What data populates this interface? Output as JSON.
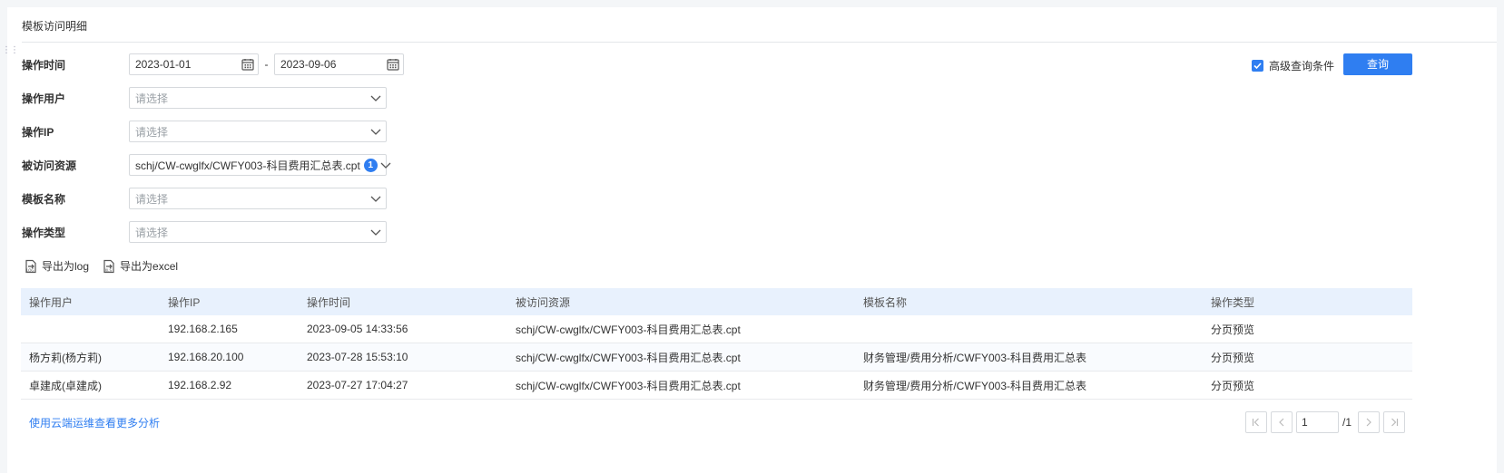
{
  "panel": {
    "title": "模板访问明细"
  },
  "filters": {
    "op_time": {
      "label": "操作时间",
      "start": "2023-01-01",
      "separator": "-",
      "end": "2023-09-06"
    },
    "op_user": {
      "label": "操作用户",
      "placeholder": "请选择"
    },
    "op_ip": {
      "label": "操作IP",
      "placeholder": "请选择"
    },
    "resource": {
      "label": "被访问资源",
      "value": "schj/CW-cwglfx/CWFY003-科目费用汇总表.cpt",
      "count": "1"
    },
    "template_name": {
      "label": "模板名称",
      "placeholder": "请选择"
    },
    "op_type": {
      "label": "操作类型",
      "placeholder": "请选择"
    }
  },
  "advanced": {
    "label": "高级查询条件",
    "checked": true
  },
  "query_button": "查询",
  "exports": {
    "log": "导出为log",
    "excel": "导出为excel"
  },
  "table": {
    "headers": [
      "操作用户",
      "操作IP",
      "操作时间",
      "被访问资源",
      "模板名称",
      "操作类型"
    ],
    "rows": [
      [
        "",
        "192.168.2.165",
        "2023-09-05 14:33:56",
        "schj/CW-cwglfx/CWFY003-科目费用汇总表.cpt",
        "",
        "分页预览"
      ],
      [
        "杨方莉(杨方莉)",
        "192.168.20.100",
        "2023-07-28 15:53:10",
        "schj/CW-cwglfx/CWFY003-科目费用汇总表.cpt",
        "财务管理/费用分析/CWFY003-科目费用汇总表",
        "分页预览"
      ],
      [
        "卓建成(卓建成)",
        "192.168.2.92",
        "2023-07-27 17:04:27",
        "schj/CW-cwglfx/CWFY003-科目费用汇总表.cpt",
        "财务管理/费用分析/CWFY003-科目费用汇总表",
        "分页预览"
      ]
    ]
  },
  "footer": {
    "cloud_link": "使用云端运维查看更多分析"
  },
  "pagination": {
    "page": "1",
    "total": "/1"
  },
  "colors": {
    "accent": "#2f7ef1",
    "header_bg": "#e8f1fd"
  },
  "icons": {
    "calendar": "calendar-icon",
    "chevron": "chevron-down-icon",
    "check": "checkbox-check-icon",
    "export": "export-file-icon",
    "first": "first-page-icon",
    "prev": "prev-page-icon",
    "next": "next-page-icon",
    "last": "last-page-icon"
  }
}
